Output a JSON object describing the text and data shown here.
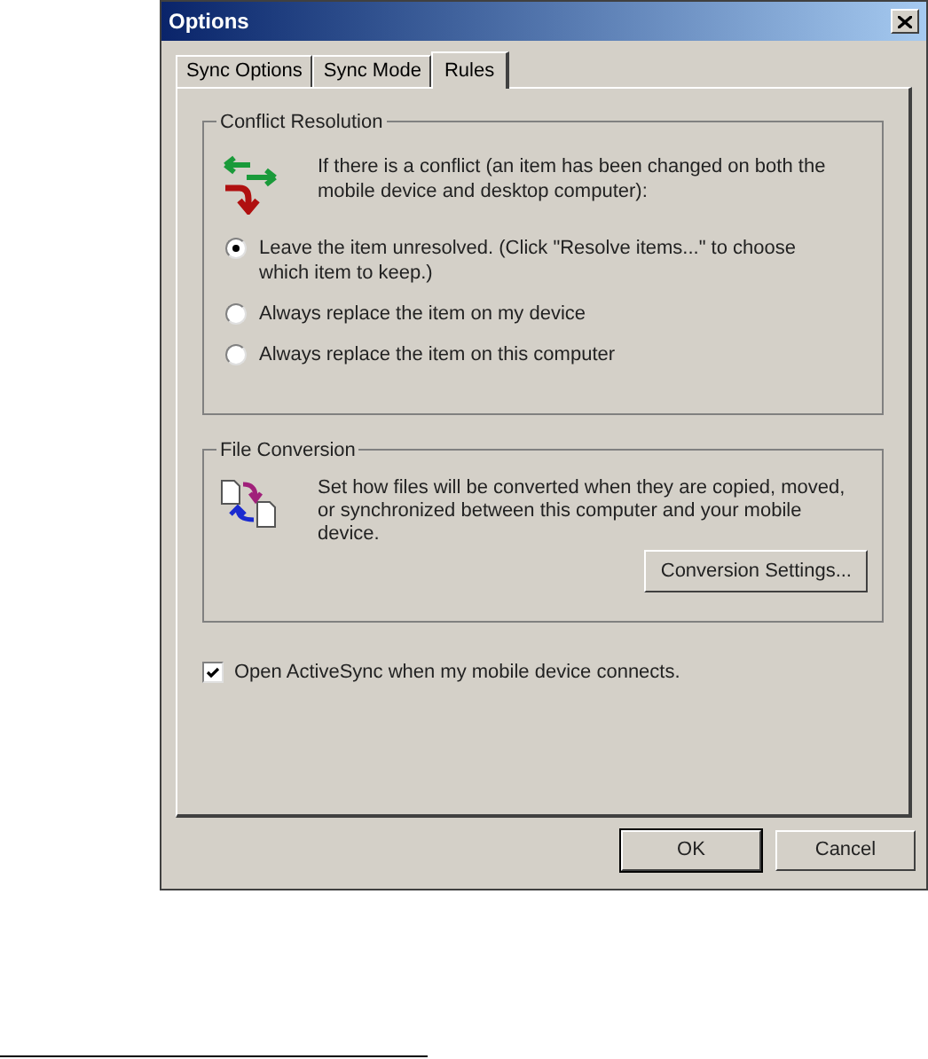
{
  "window": {
    "title": "Options"
  },
  "tabs": [
    {
      "label": "Sync Options",
      "selected": false
    },
    {
      "label": "Sync Mode",
      "selected": false
    },
    {
      "label": "Rules",
      "selected": true
    }
  ],
  "conflict_resolution": {
    "title": "Conflict Resolution",
    "description": "If there is a conflict (an item has been changed on both the mobile device and desktop computer):",
    "options": [
      {
        "label": "Leave the item unresolved. (Click \"Resolve items...\" to choose which item to keep.)",
        "selected": true
      },
      {
        "label": "Always replace the item on my device",
        "selected": false
      },
      {
        "label": "Always replace the item on this computer",
        "selected": false
      }
    ]
  },
  "file_conversion": {
    "title": "File Conversion",
    "description": "Set how files will be converted when they are copied, moved, or synchronized between this computer and your mobile device.",
    "button": "Conversion Settings..."
  },
  "open_on_connect": {
    "label": "Open ActiveSync when my mobile device connects.",
    "checked": true
  },
  "buttons": [
    "OK",
    "Cancel"
  ]
}
